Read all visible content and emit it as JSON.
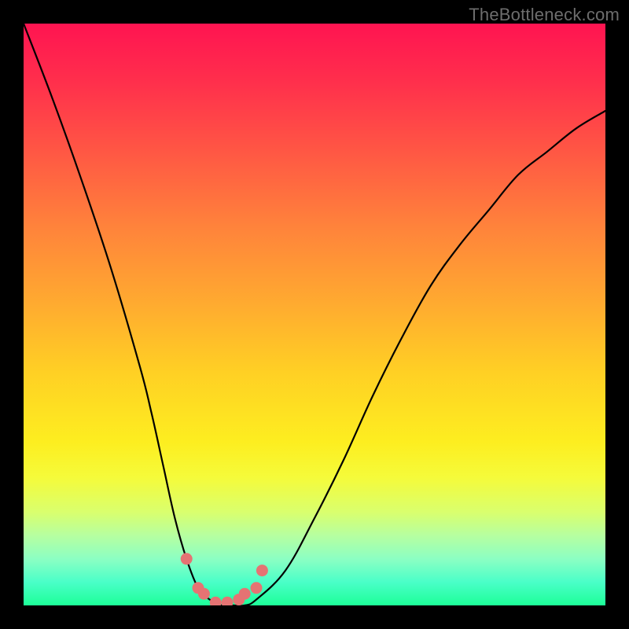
{
  "watermark": "TheBottleneck.com",
  "colors": {
    "background": "#000000",
    "curve_stroke": "#000000",
    "marker_fill": "#e57373",
    "marker_stroke": "#c85a5a"
  },
  "chart_data": {
    "type": "line",
    "title": "",
    "xlabel": "",
    "ylabel": "",
    "xlim": [
      0,
      100
    ],
    "ylim": [
      0,
      100
    ],
    "grid": false,
    "legend": false,
    "series": [
      {
        "name": "bottleneck-curve",
        "x": [
          0,
          5,
          10,
          15,
          20,
          22,
          24,
          26,
          28,
          30,
          32,
          34,
          36,
          38,
          40,
          45,
          50,
          55,
          60,
          65,
          70,
          75,
          80,
          85,
          90,
          95,
          100
        ],
        "y": [
          100,
          87,
          73,
          58,
          41,
          33,
          24,
          15,
          8,
          3,
          1,
          0,
          0,
          0,
          1,
          6,
          15,
          25,
          36,
          46,
          55,
          62,
          68,
          74,
          78,
          82,
          85
        ]
      }
    ],
    "markers": {
      "name": "highlighted-points",
      "x": [
        28,
        30,
        31,
        33,
        35,
        37,
        38,
        40,
        41
      ],
      "y": [
        8,
        3,
        2,
        0.5,
        0.5,
        1,
        2,
        3,
        6
      ]
    }
  }
}
